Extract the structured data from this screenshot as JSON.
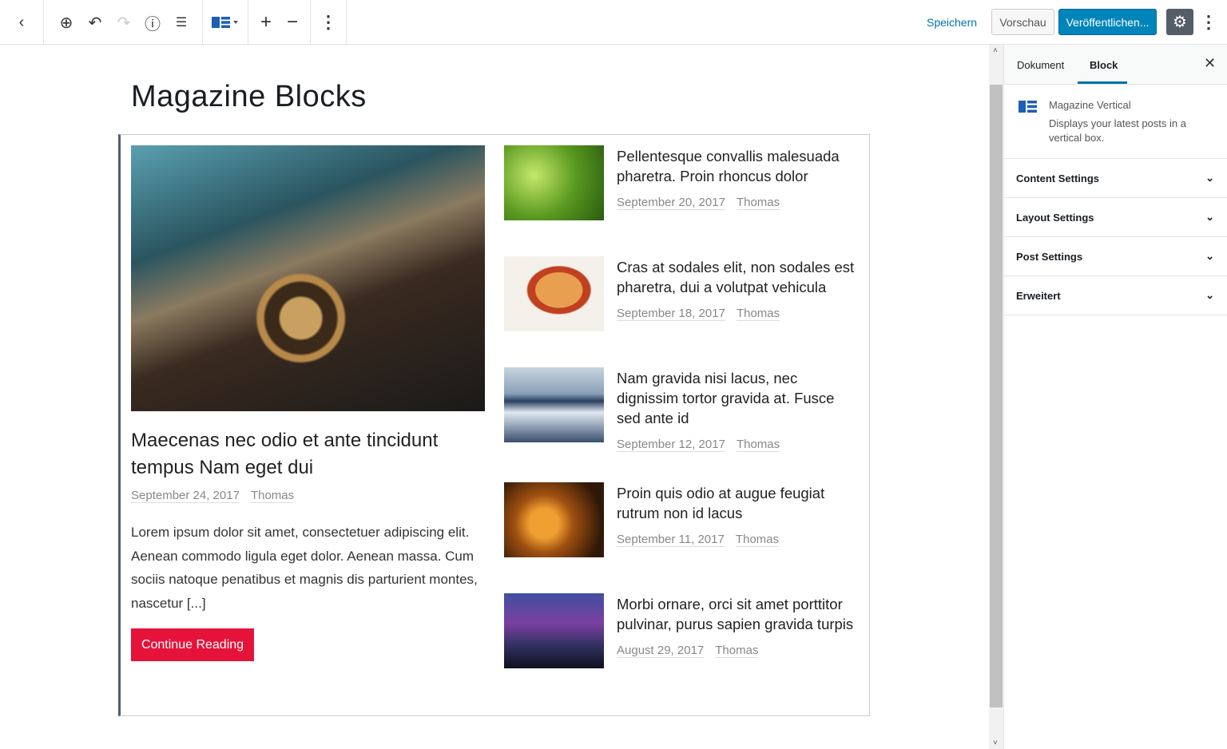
{
  "toolbar": {
    "save": "Speichern",
    "preview": "Vorschau",
    "publish": "Veröffentlichen..."
  },
  "page_title": "Magazine Blocks",
  "featured": {
    "title": "Maecenas nec odio et ante tincidunt tempus Nam eget dui",
    "date": "September 24, 2017",
    "author": "Thomas",
    "excerpt": "Lorem ipsum dolor sit amet, consectetuer adipiscing elit. Aenean commodo ligula eget dolor. Aenean massa. Cum sociis natoque penatibus et magnis dis parturient montes, nascetur [...]",
    "button": "Continue Reading"
  },
  "posts": [
    {
      "title": "Pellentesque convallis malesuada pharetra. Proin rhoncus dolor",
      "date": "September 20, 2017",
      "author": "Thomas"
    },
    {
      "title": "Cras at sodales elit, non sodales est pharetra, dui a volutpat vehicula",
      "date": "September 18, 2017",
      "author": "Thomas"
    },
    {
      "title": "Nam gravida nisi lacus, nec dignissim tortor gravida at. Fusce sed ante id",
      "date": "September 12, 2017",
      "author": "Thomas"
    },
    {
      "title": "Proin quis odio at augue feugiat rutrum non id lacus",
      "date": "September 11, 2017",
      "author": "Thomas"
    },
    {
      "title": "Morbi ornare, orci sit amet porttitor pulvinar, purus sapien gravida turpis",
      "date": "August 29, 2017",
      "author": "Thomas"
    }
  ],
  "sidebar": {
    "tabs": [
      "Dokument",
      "Block"
    ],
    "block_name": "Magazine Vertical",
    "block_desc": "Displays your latest posts in a vertical box.",
    "panels": [
      "Content Settings",
      "Layout Settings",
      "Post Settings",
      "Erweitert"
    ]
  },
  "colors": {
    "accent": "#0085ba",
    "button": "#e5133a"
  }
}
